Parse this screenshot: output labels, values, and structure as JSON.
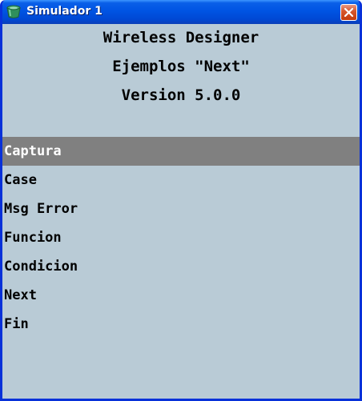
{
  "window": {
    "title": "Simulador 1",
    "icon": "simulator-app-icon",
    "close_icon": "close-icon"
  },
  "header": {
    "line1": "Wireless Designer",
    "line2": "Ejemplos \"Next\"",
    "line3": "Version 5.0.0"
  },
  "menu": {
    "selected_index": 0,
    "items": [
      {
        "label": "Captura"
      },
      {
        "label": "Case"
      },
      {
        "label": "Msg Error"
      },
      {
        "label": "Funcion"
      },
      {
        "label": "Condicion"
      },
      {
        "label": "Next"
      },
      {
        "label": "Fin"
      }
    ]
  },
  "colors": {
    "background": "#b9cbd6",
    "selection": "#808080",
    "title_bar": "#0054e3",
    "close_button": "#d7582e"
  }
}
